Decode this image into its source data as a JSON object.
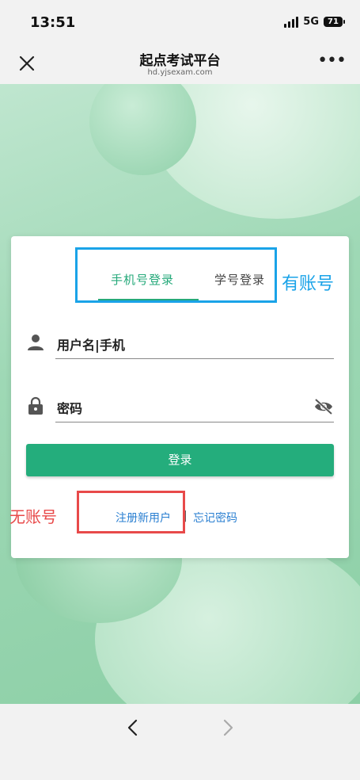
{
  "status_bar": {
    "time": "13:51",
    "network": "5G",
    "battery": "71"
  },
  "nav": {
    "title": "起点考试平台",
    "url": "hd.yjsexam.com"
  },
  "tabs": [
    {
      "label": "手机号登录",
      "active": true
    },
    {
      "label": "学号登录",
      "active": false
    }
  ],
  "form": {
    "username_label": "用户名|手机",
    "password_label": "密码",
    "login_button": "登录"
  },
  "links": {
    "register": "注册新用户",
    "separator": "|",
    "forgot": "忘记密码"
  },
  "annotations": {
    "has_account": "有账号",
    "no_account": "无账号"
  },
  "colors": {
    "accent": "#24ad7c",
    "link": "#2a7fd1",
    "annot_blue": "#1aa3e8",
    "annot_red": "#e84a4a"
  }
}
